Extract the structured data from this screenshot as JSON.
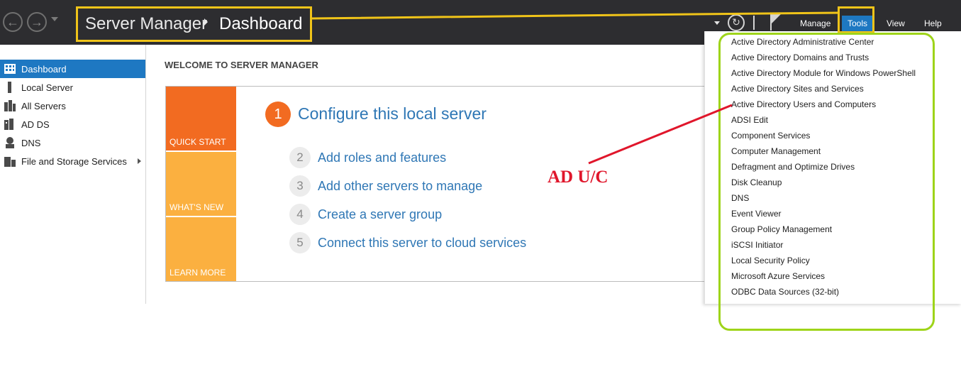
{
  "titlebar": {
    "app_title": "Server Manager",
    "page_title": "Dashboard",
    "menus": [
      "Manage",
      "Tools",
      "View",
      "Help"
    ]
  },
  "sidebar": {
    "items": [
      {
        "label": "Dashboard",
        "icon": "dashboard-icon",
        "active": true
      },
      {
        "label": "Local Server",
        "icon": "server-icon"
      },
      {
        "label": "All Servers",
        "icon": "servers-icon"
      },
      {
        "label": "AD DS",
        "icon": "ad-ds-icon"
      },
      {
        "label": "DNS",
        "icon": "dns-icon"
      },
      {
        "label": "File and Storage Services",
        "icon": "storage-icon",
        "has_submenu": true
      }
    ]
  },
  "main": {
    "heading": "WELCOME TO SERVER MANAGER",
    "tiles": [
      "QUICK START",
      "WHAT'S NEW",
      "LEARN MORE"
    ],
    "steps": [
      {
        "number": "1",
        "label": "Configure this local server"
      },
      {
        "number": "2",
        "label": "Add roles and features"
      },
      {
        "number": "3",
        "label": "Add other servers to manage"
      },
      {
        "number": "4",
        "label": "Create a server group"
      },
      {
        "number": "5",
        "label": "Connect this server to cloud services"
      }
    ]
  },
  "tools_menu": {
    "items": [
      "Active Directory Administrative Center",
      "Active Directory Domains and Trusts",
      "Active Directory Module for Windows PowerShell",
      "Active Directory Sites and Services",
      "Active Directory Users and Computers",
      "ADSI Edit",
      "Component Services",
      "Computer Management",
      "Defragment and Optimize Drives",
      "Disk Cleanup",
      "DNS",
      "Event Viewer",
      "Group Policy Management",
      "iSCSI Initiator",
      "Local Security Policy",
      "Microsoft Azure Services",
      "ODBC Data Sources (32-bit)"
    ]
  },
  "annotation": {
    "text": "AD U/C",
    "color": "#e0162b"
  },
  "colors": {
    "titlebar": "#2d2d30",
    "accent": "#1e78c2",
    "quick_start": "#f26b21",
    "tile": "#fbb040",
    "highlight_yellow": "#f0c419",
    "highlight_green": "#9ed41a"
  }
}
